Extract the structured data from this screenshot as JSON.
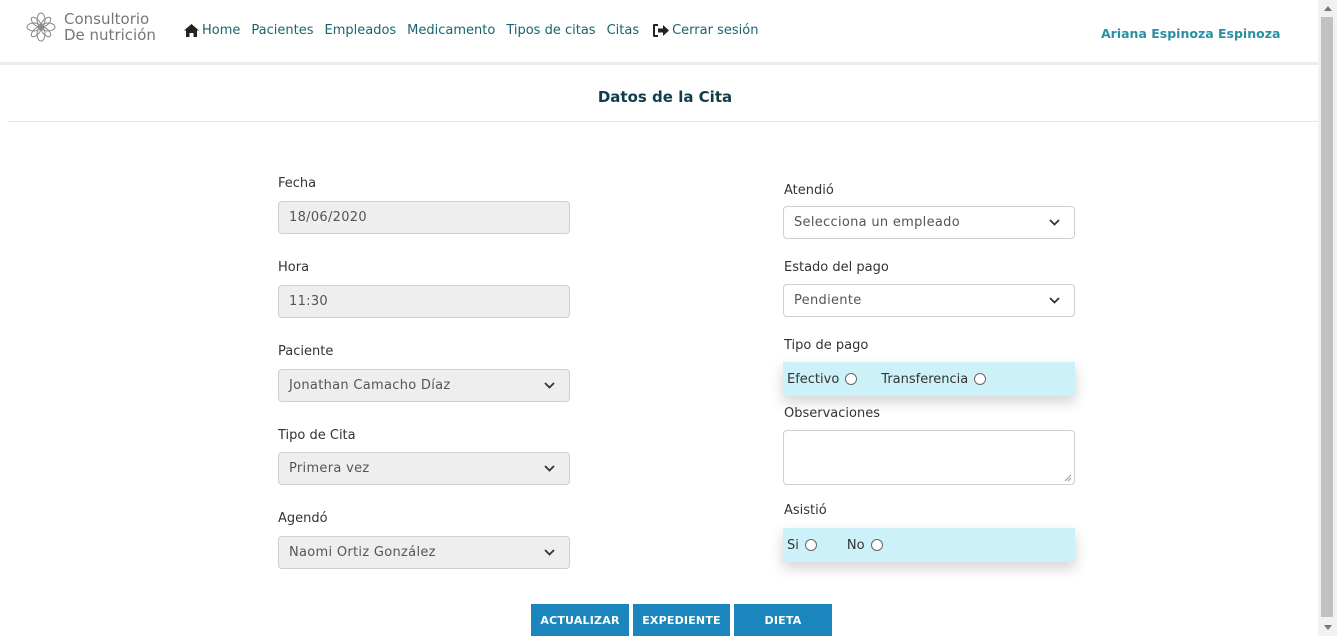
{
  "brand": {
    "line1": "Consultorio",
    "line2": "De nutrición"
  },
  "nav": {
    "home": "Home",
    "pacientes": "Pacientes",
    "empleados": "Empleados",
    "medicamento": "Medicamento",
    "tipos_citas": "Tipos de citas",
    "citas": "Citas",
    "logout": "Cerrar sesión"
  },
  "user": {
    "name": "Ariana Espinoza Espinoza"
  },
  "page": {
    "title": "Datos de la Cita"
  },
  "form_left": {
    "fecha_label": "Fecha",
    "fecha_value": "18/06/2020",
    "hora_label": "Hora",
    "hora_value": "11:30",
    "paciente_label": "Paciente",
    "paciente_value": "Jonathan Camacho Díaz",
    "tipo_label": "Tipo de Cita",
    "tipo_value": "Primera vez",
    "agendo_label": "Agendó",
    "agendo_value": "Naomi Ortiz González"
  },
  "form_right": {
    "atendio_label": "Atendió",
    "atendio_value": "Selecciona un empleado",
    "estado_label": "Estado del pago",
    "estado_value": "Pendiente",
    "tipo_pago_label": "Tipo de pago",
    "pago_opt1": "Efectivo",
    "pago_opt2": "Transferencia",
    "obs_label": "Observaciones",
    "asistio_label": "Asistió",
    "asistio_opt1": "Si",
    "asistio_opt2": "No"
  },
  "buttons": {
    "actualizar": "ACTUALIZAR",
    "expediente": "EXPEDIENTE",
    "dieta": "DIETA"
  },
  "colors": {
    "accent": "#1b86bd",
    "highlight": "#cdf1f8",
    "title": "#0f3d48",
    "nav": "#1a6470"
  },
  "icons": {
    "logo": "flower-logo-icon",
    "home": "home-icon",
    "logout": "logout-icon",
    "select": "chevron-down-icon"
  }
}
